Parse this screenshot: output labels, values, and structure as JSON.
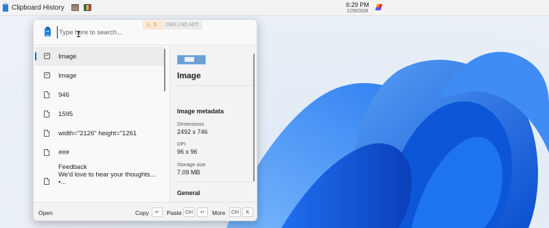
{
  "taskbar": {
    "app_title": "Clipboard History",
    "clock_time": "6:29 PM",
    "clock_date": "1/29/2026"
  },
  "popup": {
    "search_placeholder": "Type here to search...",
    "debug_badge": {
      "warning_count": "5",
      "mode_text": "DBG | NO AOT"
    },
    "list": [
      {
        "label": "Image",
        "icon": "image-icon",
        "selected": true
      },
      {
        "label": "Image",
        "icon": "image-icon"
      },
      {
        "label": "946",
        "icon": "document-icon"
      },
      {
        "label": "1595",
        "icon": "document-icon"
      },
      {
        "label": "width=\"2126\" height=\"1261",
        "icon": "document-icon"
      },
      {
        "label": "###",
        "icon": "document-icon"
      },
      {
        "label_lines": [
          "Feedback",
          "We'd love to hear your thoughts...",
          "•..."
        ],
        "icon": "document-icon"
      }
    ],
    "detail": {
      "title": "Image",
      "metadata_heading": "Image metadata",
      "dimensions_label": "Dimensions",
      "dimensions_value": "2492 x 746",
      "dpi_label": "DPI",
      "dpi_value": "96 x 96",
      "storage_label": "Storage size",
      "storage_value": "7.09 MB",
      "general_heading": "General"
    },
    "footer": {
      "open_label": "Open",
      "copy_label": "Copy",
      "copy_key": "↵",
      "paste_label": "Paste",
      "paste_key1": "Ctrl",
      "paste_key2": "↵",
      "more_label": "More",
      "more_key1": "Ctrl",
      "more_key2": "K"
    }
  },
  "colors": {
    "accent": "#1f5fa8",
    "wallpaper_bloom": "#1a6fe8"
  }
}
